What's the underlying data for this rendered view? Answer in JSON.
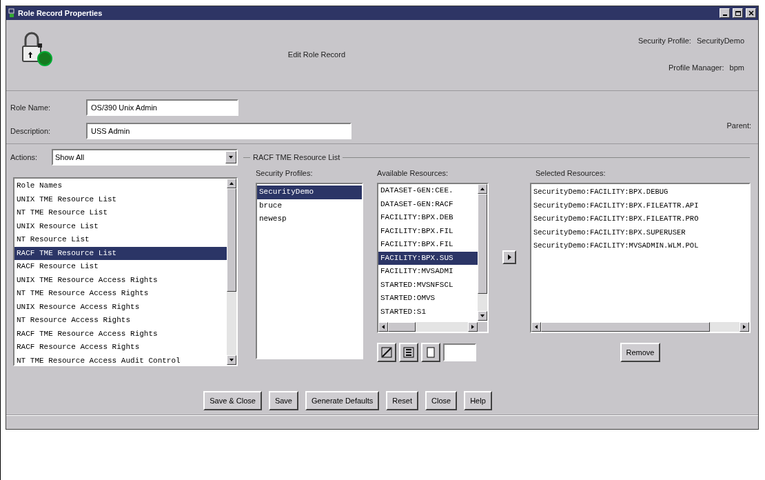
{
  "window": {
    "title": "Role Record Properties"
  },
  "header": {
    "heading": "Edit Role Record",
    "security_profile_label": "Security Profile:",
    "security_profile": "SecurityDemo",
    "profile_manager_label": "Profile Manager:",
    "profile_manager": "bpm"
  },
  "form": {
    "role_name_label": "Role Name:",
    "role_name": "OS/390 Unix Admin",
    "description_label": "Description:",
    "description": "USS Admin",
    "parent_label": "Parent:",
    "actions_label": "Actions:",
    "actions_value": "Show All"
  },
  "views": [
    {
      "label": "Role Names",
      "selected": false
    },
    {
      "label": "UNIX TME Resource List",
      "selected": false
    },
    {
      "label": "NT TME Resource List",
      "selected": false
    },
    {
      "label": "UNIX Resource List",
      "selected": false
    },
    {
      "label": "NT Resource List",
      "selected": false
    },
    {
      "label": "RACF TME Resource List",
      "selected": true
    },
    {
      "label": "RACF Resource List",
      "selected": false
    },
    {
      "label": "UNIX TME Resource Access Rights",
      "selected": false
    },
    {
      "label": "NT TME Resource Access Rights",
      "selected": false
    },
    {
      "label": "UNIX Resource Access Rights",
      "selected": false
    },
    {
      "label": "NT Resource Access Rights",
      "selected": false
    },
    {
      "label": "RACF TME Resource Access Rights",
      "selected": false
    },
    {
      "label": "RACF Resource Access Rights",
      "selected": false
    },
    {
      "label": "NT TME Resource Access Audit Control",
      "selected": false
    }
  ],
  "group": {
    "title": "RACF TME Resource List",
    "profiles_label": "Security Profiles:",
    "available_label": "Available Resources:",
    "selected_label": "Selected Resources:",
    "remove": "Remove"
  },
  "profiles": [
    {
      "label": "SecurityDemo",
      "selected": true
    },
    {
      "label": "bruce",
      "selected": false
    },
    {
      "label": "newesp",
      "selected": false
    }
  ],
  "available": [
    {
      "label": "DATASET-GEN:CEE.",
      "selected": false
    },
    {
      "label": "DATASET-GEN:RACF",
      "selected": false
    },
    {
      "label": "FACILITY:BPX.DEB",
      "selected": false
    },
    {
      "label": "FACILITY:BPX.FIL",
      "selected": false
    },
    {
      "label": "FACILITY:BPX.FIL",
      "selected": false
    },
    {
      "label": "FACILITY:BPX.SUS",
      "selected": true
    },
    {
      "label": "FACILITY:MVSADMI",
      "selected": false
    },
    {
      "label": "STARTED:MVSNFSCL",
      "selected": false
    },
    {
      "label": "STARTED:OMVS",
      "selected": false
    },
    {
      "label": "STARTED:S1",
      "selected": false
    }
  ],
  "chosen": [
    "SecurityDemo:FACILITY:BPX.DEBUG",
    "SecurityDemo:FACILITY:BPX.FILEATTR.API",
    "SecurityDemo:FACILITY:BPX.FILEATTR.PRO",
    "SecurityDemo:FACILITY:BPX.SUPERUSER",
    "SecurityDemo:FACILITY:MVSADMIN.WLM.POL"
  ],
  "buttons": [
    "Save & Close",
    "Save",
    "Generate Defaults",
    "Reset",
    "Close",
    "Help"
  ]
}
